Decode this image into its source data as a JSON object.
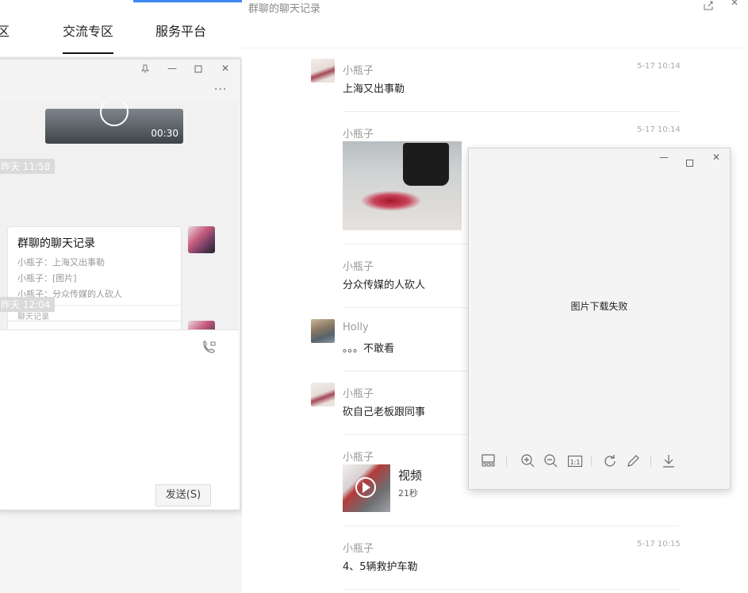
{
  "left_app": {
    "nav": {
      "tab_partial": "区",
      "tab_community": "交流专区",
      "tab_service": "服务平台"
    },
    "chat": {
      "video_duration": "00:30",
      "time1": "昨天 11:58",
      "record_card": {
        "title": "群聊的聊天记录",
        "lines": [
          "小瓶子：上海又出事勒",
          "小瓶子：[图片]",
          "小瓶子：分众传媒的人砍人"
        ],
        "footer": "聊天记录"
      },
      "time2": "昨天 12:04",
      "send_label": "发送(S)"
    }
  },
  "history": {
    "title": "群聊的聊天记录",
    "messages": [
      {
        "name": "小瓶子",
        "time": "5-17 10:14",
        "text": "上海又出事勒"
      },
      {
        "name": "小瓶子",
        "time": "5-17 10:14",
        "text": ""
      },
      {
        "name": "小瓶子",
        "time": "",
        "text": "分众传媒的人砍人"
      },
      {
        "name": "Holly",
        "time": "",
        "text": "。。。不敢看"
      },
      {
        "name": "小瓶子",
        "time": "",
        "text": "砍自己老板跟同事"
      },
      {
        "name": "小瓶子",
        "time": "",
        "video_title": "视频",
        "video_duration": "21秒"
      },
      {
        "name": "小瓶子",
        "time": "5-17 10:15",
        "text": "4、5辆救护车勒"
      }
    ]
  },
  "viewer": {
    "message": "图片下载失败"
  }
}
